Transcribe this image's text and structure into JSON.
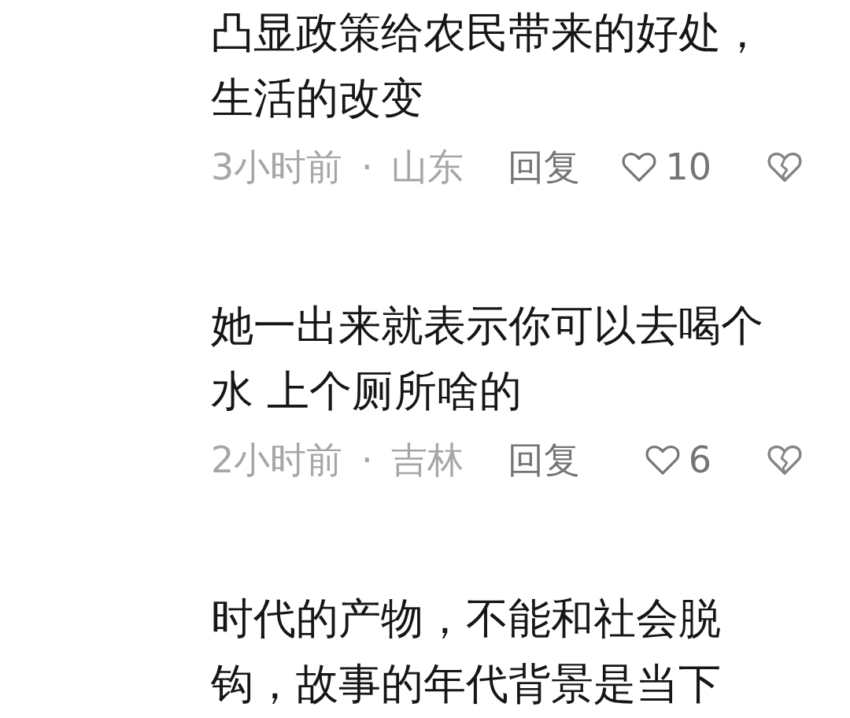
{
  "comments": [
    {
      "text": "凸显政策给农民带来的好处，生活的改变",
      "meta": "3小时前 · 山东",
      "reply": "回复",
      "likes": "10",
      "liked": false,
      "disliked": false
    },
    {
      "text": "她一出来就表示你可以去喝个水 上个厕所啥的",
      "meta": "2小时前 · 吉林",
      "reply": "回复",
      "likes": "6",
      "liked": false,
      "disliked": false
    },
    {
      "text": "时代的产物，不能和社会脱钩，故事的年代背景是当下"
    }
  ]
}
